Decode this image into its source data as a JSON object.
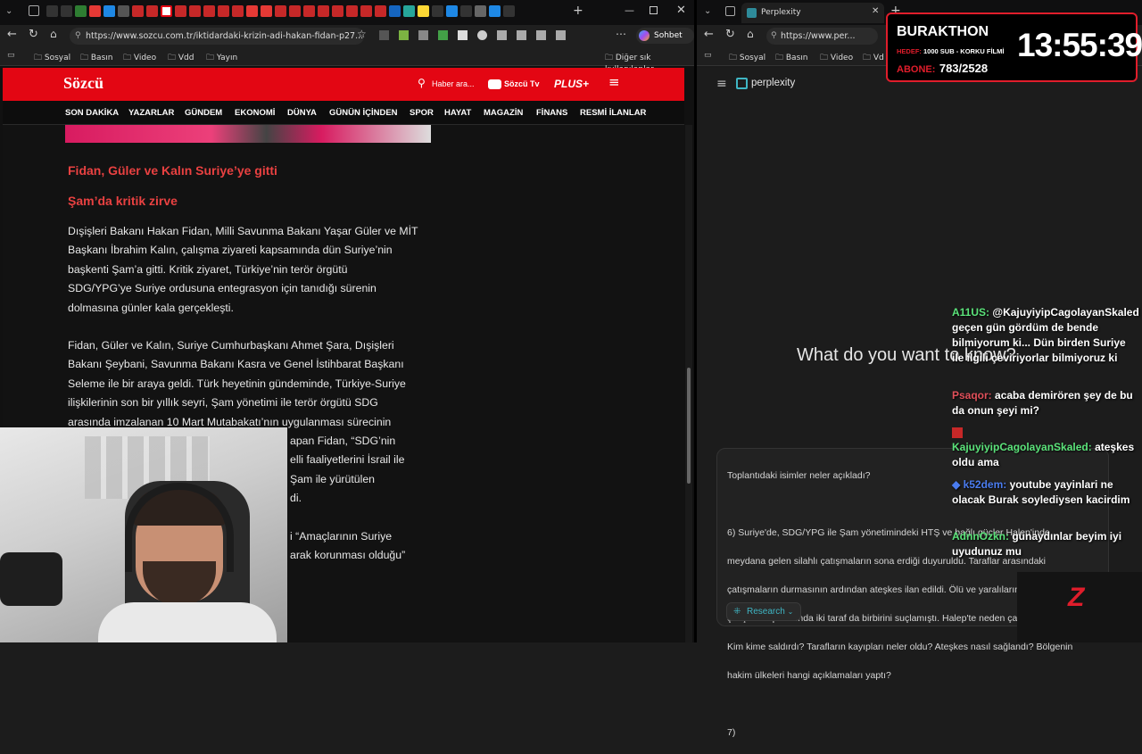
{
  "left_browser": {
    "url": "https://www.sozcu.com.tr/iktidardaki-krizin-adi-hakan-fidan-p27...",
    "copilot_label": "Sohbet et",
    "bookmarks": [
      "Sosyal",
      "Basın",
      "Video",
      "Vdd",
      "Yayın"
    ],
    "other_bookmarks": "Diğer sık kullanılanlar"
  },
  "sozcu": {
    "logo": "Sözcü",
    "search_label": "Haber ara...",
    "tv_label": "Sözcü Tv",
    "plus_label": "PLUS+",
    "nav": [
      "SON DAKİKA",
      "YAZARLAR",
      "GÜNDEM",
      "EKONOMİ",
      "DÜNYA",
      "GÜNÜN İÇİNDEN",
      "SPOR",
      "HAYAT",
      "MAGAZİN",
      "FİNANS",
      "RESMİ İLANLAR"
    ],
    "heading1": "Fidan, Güler ve Kalın Suriye’ye gitti",
    "heading2": "Şam’da kritik zirve",
    "para1": [
      "Dışişleri Bakanı Hakan Fidan, Milli Savunma Bakanı Yaşar Güler ve MİT",
      "Başkanı İbrahim Kalın, çalışma ziyareti kapsamında dün Suriye’nin",
      "başkenti Şam’a gitti. Kritik ziyaret, Türkiye’nin terör örgütü",
      "SDG/YPG’ye Suriye ordusuna entegrasyon için tanıdığı sürenin",
      "dolmasına günler kala gerçekleşti."
    ],
    "para2": [
      "Fidan, Güler ve Kalın, Suriye Cumhurbaşkanı Ahmet Şara, Dışişleri",
      "Bakanı Şeybani, Savunma Bakanı Kasra ve Genel İstihbarat Başkanı",
      "Seleme ile bir araya geldi. Türk heyetinin gündeminde, Türkiye-Suriye",
      "ilişkilerinin son bir yıllık seyri, Şam yönetimi ile terör örgütü SDG",
      "arasında imzalanan 10 Mart Mutabakatı’nın uygulanması sürecinin"
    ],
    "para2_partial": [
      "apan Fidan, “SDG’nin",
      "elli faaliyetlerini İsrail ile",
      "Şam ile yürütülen",
      "di."
    ],
    "para3_partial": [
      "i “Amaçlarının Suriye",
      "arak korunması olduğu”"
    ]
  },
  "right_browser": {
    "tab_title": "Perplexity",
    "url": "https://www.per...",
    "bookmarks": [
      "Sosyal",
      "Basın",
      "Video",
      "Vd"
    ],
    "brand": "perplexity",
    "hero": "What do you want to know?",
    "prompt_lines": [
      "Toplantıdaki isimler neler açıkladı?",
      "",
      "6) Suriye'de, SDG/YPG ile Şam yönetimindeki HTŞ ve bağlı güçler Halep'inde",
      "meydana gelen silahlı çatışmaların sona erdiği duyuruldu. Taraflar arasındaki",
      "çatışmaların durmasının ardından ateşkes ilan edildi. Ölü ve yaralıların olduğu",
      "çatışma kapsamında iki taraf da birbirini suçlamıştı. Halep'te neden çatışma çıktı?",
      "Kim kime saldırdı? Tarafların kayıpları neler oldu? Ateşkes nasıl sağlandı? Bölgenin",
      "hakim ülkeleri hangi açıklamaları yaptı?",
      "",
      "7)"
    ],
    "research_label": "Research"
  },
  "overlay": {
    "badge_name": "BURAKTHON",
    "badge_hedef_label": "HEDEF:",
    "badge_hedef": "1000 SUB - KORKU FİLMİ",
    "badge_abone_label": "ABONE:",
    "badge_abone": "783/2528",
    "timer": "13:55:39",
    "chat": [
      {
        "user": "A11US:",
        "color": "#5be37a",
        "text": "@KajuyiyipCagolayanSkaled geçen gün gördüm de bende bilmiyorum ki... Dün birden Suriye ile ilgili çeviriyorlar bilmiyoruz ki"
      },
      {
        "user": "Psaqor:",
        "color": "#e0505a",
        "text": "acaba demirören şey de bu da onun şeyi mi?"
      },
      {
        "user": "KajuyiyipCagolayanSkaled:",
        "color": "#5be37a",
        "text": "ateşkes oldu ama"
      },
      {
        "user": "k52dem:",
        "color": "#4a7cf0",
        "text": "youtube yayinlari ne olacak Burak soylediysen kacirdim"
      },
      {
        "user": "AdnnOzkn:",
        "color": "#5be37a",
        "text": "günaydınlar beyim iyi uyudunuz mu"
      }
    ],
    "logo_letter": "Z"
  }
}
